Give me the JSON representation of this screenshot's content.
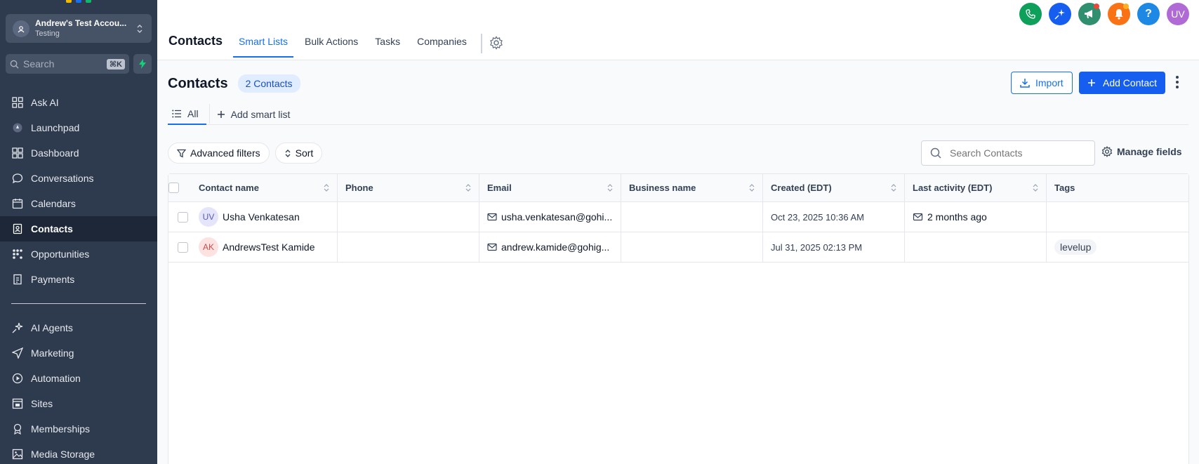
{
  "sidebar": {
    "account": {
      "name": "Andrew's Test Accou...",
      "sub": "Testing"
    },
    "search": {
      "placeholder": "Search",
      "shortcut": "⌘K"
    },
    "items_top": [
      {
        "label": "Ask AI",
        "icon": "grid-icon"
      },
      {
        "label": "Launchpad",
        "icon": "rocket-icon"
      },
      {
        "label": "Dashboard",
        "icon": "dashboard-icon"
      },
      {
        "label": "Conversations",
        "icon": "chat-icon"
      },
      {
        "label": "Calendars",
        "icon": "calendar-icon"
      },
      {
        "label": "Contacts",
        "icon": "contacts-icon",
        "active": true
      },
      {
        "label": "Opportunities",
        "icon": "opportunities-icon"
      },
      {
        "label": "Payments",
        "icon": "payments-icon"
      }
    ],
    "items_bottom": [
      {
        "label": "AI Agents",
        "icon": "sparkle-icon"
      },
      {
        "label": "Marketing",
        "icon": "send-icon"
      },
      {
        "label": "Automation",
        "icon": "automation-icon"
      },
      {
        "label": "Sites",
        "icon": "sites-icon"
      },
      {
        "label": "Memberships",
        "icon": "membership-icon"
      },
      {
        "label": "Media Storage",
        "icon": "image-icon"
      }
    ],
    "logo_colors": [
      "#f5b800",
      "#1570ef",
      "#12b76a"
    ]
  },
  "header": {
    "title": "Contacts",
    "tabs": [
      "Smart Lists",
      "Bulk Actions",
      "Tasks",
      "Companies"
    ],
    "active_tab": "Smart Lists",
    "avatar_initials": "UV",
    "icon_colors": {
      "phone": "#0e9f5b",
      "ai": "#155eef",
      "announce": "#2f8f6e",
      "bell": "#f97316",
      "help": "#1e88e5",
      "avatar": "#b06ad6"
    }
  },
  "main": {
    "title": "Contacts",
    "count_badge": "2 Contacts",
    "import_label": "Import",
    "add_label": "Add Contact",
    "subtabs": {
      "all": "All",
      "add": "Add smart list"
    },
    "advanced_filters": "Advanced filters",
    "sort": "Sort",
    "search_placeholder": "Search Contacts",
    "manage_fields": "Manage fields"
  },
  "table": {
    "headers": [
      "Contact name",
      "Phone",
      "Email",
      "Business name",
      "Created (EDT)",
      "Last activity (EDT)",
      "Tags"
    ],
    "rows": [
      {
        "initials": "UV",
        "avatar_bg": "#e4e4fb",
        "avatar_fg": "#5b5bb8",
        "name": "Usha Venkatesan",
        "phone": "",
        "email": "usha.venkatesan@gohi...",
        "business": "",
        "created": "Oct 23, 2025 10:36 AM",
        "activity": "2 months ago",
        "tag": ""
      },
      {
        "initials": "AK",
        "avatar_bg": "#fde2e2",
        "avatar_fg": "#c0504d",
        "name": "AndrewsTest Kamide",
        "phone": "",
        "email": "andrew.kamide@gohig...",
        "business": "",
        "created": "Jul 31, 2025 02:13 PM",
        "activity": "",
        "tag": "levelup"
      }
    ]
  }
}
